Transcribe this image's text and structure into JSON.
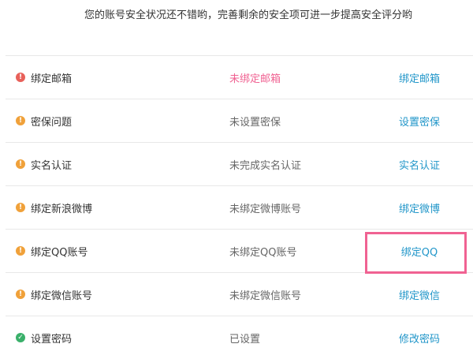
{
  "header": {
    "message": "您的账号安全状况还不错哟，完善剩余的安全项可进一步提高安全评分哟"
  },
  "colors": {
    "danger": "#e8615a",
    "warning": "#f0a13a",
    "ok": "#3ab06a",
    "link": "#2196c9",
    "highlight": "#f06292"
  },
  "items": [
    {
      "name": "绑定邮箱",
      "status": "未绑定邮箱",
      "action": "绑定邮箱",
      "level": "red",
      "icon": "exclamation-icon"
    },
    {
      "name": "密保问题",
      "status": "未设置密保",
      "action": "设置密保",
      "level": "orange",
      "icon": "exclamation-icon"
    },
    {
      "name": "实名认证",
      "status": "未完成实名认证",
      "action": "实名认证",
      "level": "orange",
      "icon": "exclamation-icon"
    },
    {
      "name": "绑定新浪微博",
      "status": "未绑定微博账号",
      "action": "绑定微博",
      "level": "orange",
      "icon": "exclamation-icon"
    },
    {
      "name": "绑定QQ账号",
      "status": "未绑定QQ账号",
      "action": "绑定QQ",
      "level": "orange",
      "icon": "exclamation-icon"
    },
    {
      "name": "绑定微信账号",
      "status": "未绑定微信账号",
      "action": "绑定微信",
      "level": "orange",
      "icon": "exclamation-icon"
    },
    {
      "name": "设置密码",
      "status": "已设置",
      "action": "修改密码",
      "level": "green",
      "icon": "check-icon"
    }
  ]
}
